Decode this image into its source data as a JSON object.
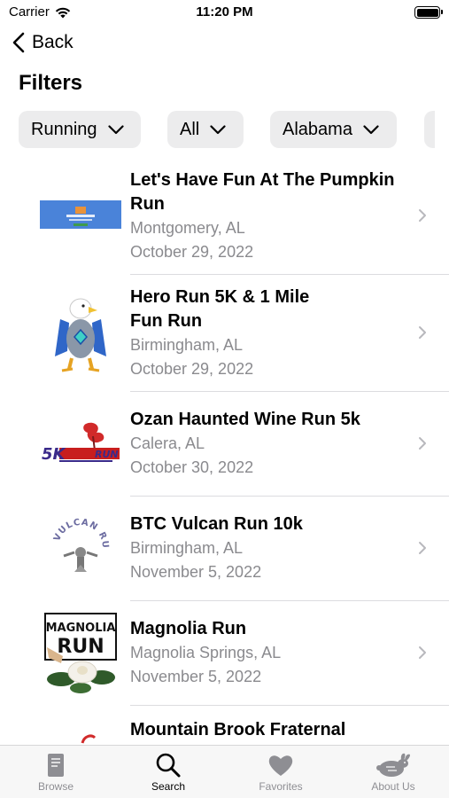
{
  "status_bar": {
    "carrier": "Carrier",
    "time": "11:20 PM"
  },
  "nav": {
    "back_label": "Back"
  },
  "filters": {
    "title": "Filters",
    "chips": [
      {
        "label": "Running"
      },
      {
        "label": "All"
      },
      {
        "label": "Alabama"
      }
    ]
  },
  "events": [
    {
      "title": "Let's Have Fun At The Pumpkin Run",
      "location": "Montgomery, AL",
      "date": "October 29, 2022"
    },
    {
      "title": "Hero Run 5K & 1 Mile Fun Run",
      "location": "Birmingham, AL",
      "date": "October 29, 2022"
    },
    {
      "title": "Ozan Haunted Wine Run 5k",
      "location": "Calera, AL",
      "date": "October 30, 2022"
    },
    {
      "title": "BTC Vulcan Run 10k",
      "location": "Birmingham, AL",
      "date": "November 5, 2022"
    },
    {
      "title": "Magnolia Run",
      "location": "Magnolia Springs, AL",
      "date": "November 5, 2022"
    },
    {
      "title": "Mountain Brook Fraternal",
      "location": "",
      "date": ""
    }
  ],
  "logos": {
    "ozan_5k": "5K",
    "ozan_run": "RUN",
    "vulcan": "VULCAN RUN",
    "magnolia_1": "MAGNOLIA",
    "magnolia_2": "RUN"
  },
  "tab_bar": {
    "tabs": [
      {
        "label": "Browse",
        "icon": "book-icon"
      },
      {
        "label": "Search",
        "icon": "search-icon"
      },
      {
        "label": "Favorites",
        "icon": "heart-icon"
      },
      {
        "label": "About Us",
        "icon": "rabbit-icon"
      }
    ],
    "active": "Search"
  },
  "colors": {
    "chip_bg": "#ececed",
    "secondary_text": "#8a8a8e",
    "tab_inactive": "#8e8e93",
    "separator": "#dcdcdf"
  }
}
